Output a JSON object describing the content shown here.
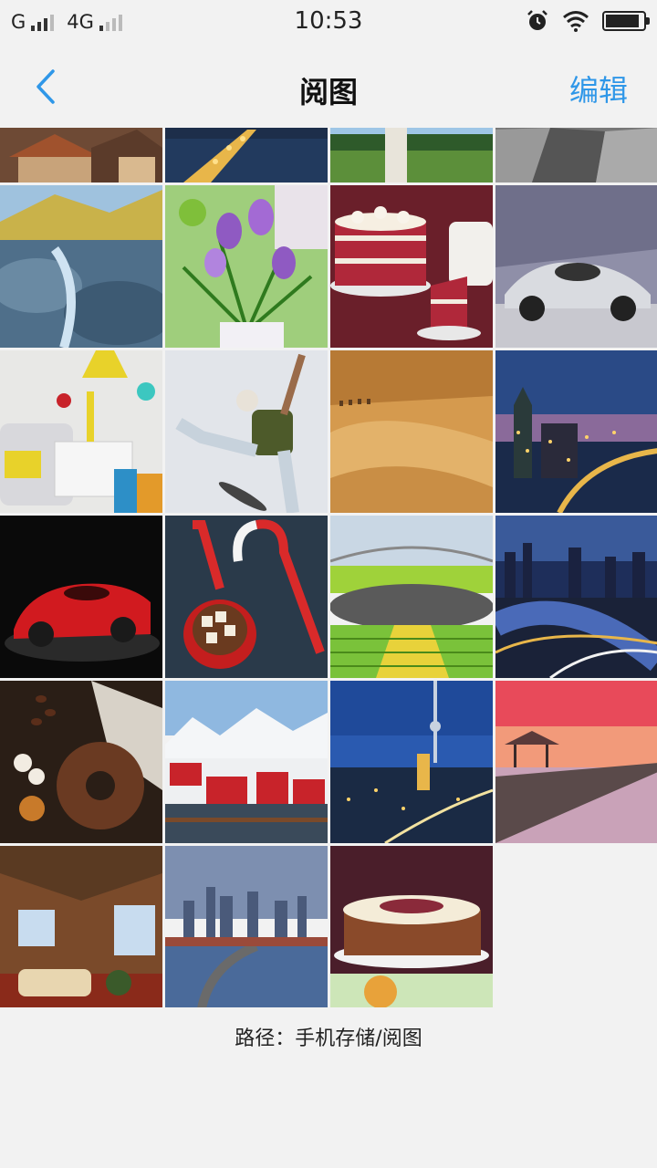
{
  "status": {
    "carrier1": "G",
    "carrier2": "4G",
    "time": "10:53",
    "battery_level": 0.9,
    "icons": [
      "signal-icon",
      "alarm-icon",
      "wifi-icon",
      "battery-icon"
    ]
  },
  "nav": {
    "back_icon": "chevron-left-icon",
    "title": "阅图",
    "edit_label": "编辑",
    "accent_color": "#2f97e8"
  },
  "gallery": {
    "photos": [
      {
        "subject": "old-town-rooftops"
      },
      {
        "subject": "night-bridge-lights"
      },
      {
        "subject": "person-on-lawn"
      },
      {
        "subject": "modern-architecture"
      },
      {
        "subject": "mountain-river-rocks"
      },
      {
        "subject": "purple-crocus-flowers"
      },
      {
        "subject": "red-velvet-cake"
      },
      {
        "subject": "silver-sports-car"
      },
      {
        "subject": "colorful-living-room"
      },
      {
        "subject": "skateboarder-jump"
      },
      {
        "subject": "desert-dunes-camels"
      },
      {
        "subject": "city-skyline-dusk"
      },
      {
        "subject": "red-sports-car"
      },
      {
        "subject": "candy-canes-cocoa"
      },
      {
        "subject": "olympic-stadium"
      },
      {
        "subject": "river-city-night"
      },
      {
        "subject": "chocolate-bundt-cake"
      },
      {
        "subject": "snowy-red-houses"
      },
      {
        "subject": "tv-tower-city-night"
      },
      {
        "subject": "sunset-pier"
      },
      {
        "subject": "cabin-interior"
      },
      {
        "subject": "city-skyline-river"
      },
      {
        "subject": "cream-cake-with-pear"
      }
    ]
  },
  "footer": {
    "path": "路径：手机存储/阅图"
  }
}
